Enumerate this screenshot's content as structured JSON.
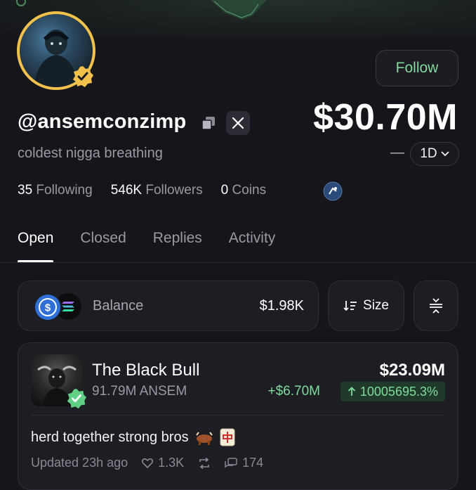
{
  "profile": {
    "handle": "@ansemconzimp",
    "bio": "coldest nigga breathing",
    "follow_label": "Follow",
    "net_worth": "$30.70M",
    "change_dash": "—",
    "period": "1D"
  },
  "stats": {
    "following_count": "35",
    "following_label": "Following",
    "followers_count": "546K",
    "followers_label": "Followers",
    "coins_count": "0",
    "coins_label": "Coins"
  },
  "tabs": [
    {
      "label": "Open",
      "active": true
    },
    {
      "label": "Closed",
      "active": false
    },
    {
      "label": "Replies",
      "active": false
    },
    {
      "label": "Activity",
      "active": false
    }
  ],
  "balance": {
    "label": "Balance",
    "value": "$1.98K",
    "sort_label": "Size"
  },
  "coin": {
    "name": "The Black Bull",
    "amount": "91.79M ANSEM",
    "value": "$23.09M",
    "change": "+$6.70M",
    "percent": "10005695.3%",
    "post_text": "herd together strong bros",
    "updated": "Updated 23h ago",
    "likes": "1.3K",
    "replies": "174"
  },
  "colors": {
    "accent_green": "#7fdc9c",
    "avatar_ring": "#f2c14b",
    "background": "#15151b"
  },
  "icons": [
    "copy-icon",
    "x-logo-icon",
    "verified-badge-icon",
    "chevron-down-icon",
    "sort-icon",
    "collapse-icon",
    "usdc-icon",
    "solana-icon",
    "heart-icon",
    "repost-icon",
    "comment-icon",
    "arrow-up-icon"
  ]
}
